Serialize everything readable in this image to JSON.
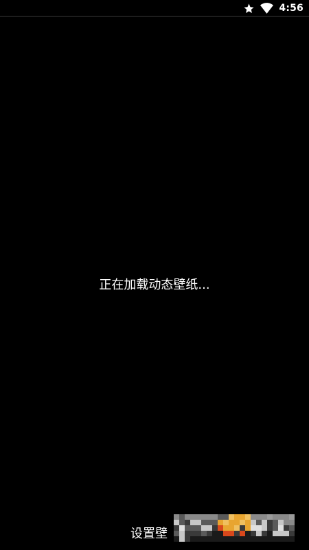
{
  "status_bar": {
    "time": "4:56",
    "icons": [
      "star-icon",
      "wifi-icon"
    ]
  },
  "main": {
    "loading_text": "正在加载动态壁纸..."
  },
  "bottom": {
    "set_wallpaper_label": "设置壁"
  },
  "colors": {
    "background": "#000000",
    "text": "#ffffff",
    "divider": "#3a3a3a",
    "accent_orange": "#e8a530",
    "accent_red": "#d9481c"
  }
}
